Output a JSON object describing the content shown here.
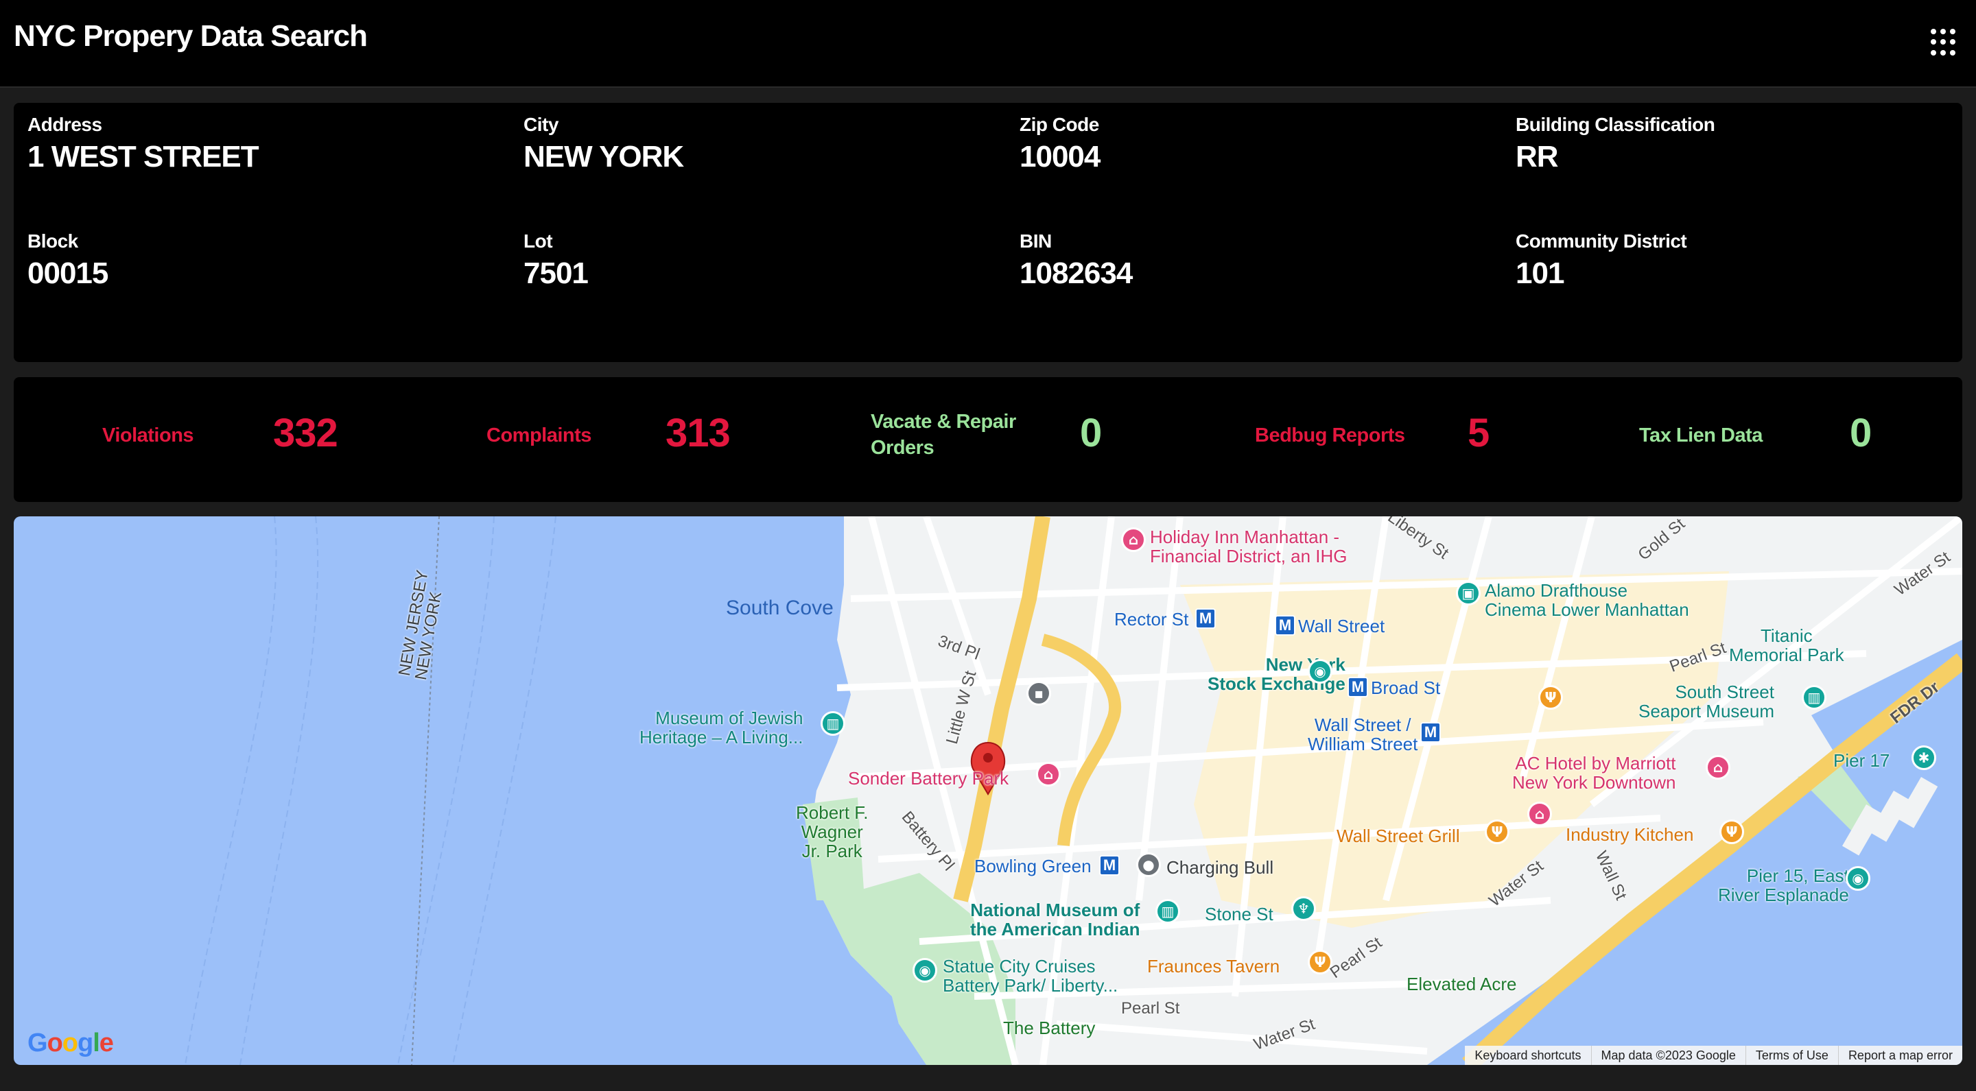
{
  "app": {
    "title": "NYC Propery Data Search"
  },
  "property": {
    "address_label": "Address",
    "address": "1 WEST STREET",
    "city_label": "City",
    "city": "NEW YORK",
    "zip_label": "Zip Code",
    "zip": "10004",
    "classification_label": "Building Classification",
    "classification": "RR",
    "block_label": "Block",
    "block": "00015",
    "lot_label": "Lot",
    "lot": "7501",
    "bin_label": "BIN",
    "bin": "1082634",
    "district_label": "Community District",
    "district": "101"
  },
  "stats": {
    "violations_label": "Violations",
    "violations": "332",
    "complaints_label": "Complaints",
    "complaints": "313",
    "vacate_label_1": "Vacate & Repair",
    "vacate_label_2": "Orders",
    "vacate": "0",
    "bedbug_label": "Bedbug Reports",
    "bedbug": "5",
    "taxlien_label": "Tax Lien Data",
    "taxlien": "0"
  },
  "colors": {
    "alert": "#e3173e",
    "ok": "#9be39b"
  },
  "map": {
    "water_labels": {
      "south_cove": "South Cove"
    },
    "border_labels": {
      "nj": "NEW JERSEY",
      "ny": "NEW YORK"
    },
    "pois": {
      "holiday_inn_1": "Holiday Inn Manhattan -",
      "holiday_inn_2": "Financial District, an IHG",
      "alamo_1": "Alamo Drafthouse",
      "alamo_2": "Cinema Lower Manhattan",
      "rector": "Rector St",
      "wall_street": "Wall Street",
      "titanic_1": "Titanic",
      "titanic_2": "Memorial Park",
      "nyse_1": "New York",
      "nyse_2": "Stock Exchange",
      "broad": "Broad St",
      "seaport_1": "South Street",
      "seaport_2": "Seaport Museum",
      "jewish_1": "Museum of Jewish",
      "jewish_2": "Heritage – A Living...",
      "wall_william_1": "Wall Street /",
      "wall_william_2": "William Street",
      "ac_hotel_1": "AC Hotel by Marriott",
      "ac_hotel_2": "New York Downtown",
      "pier17": "Pier 17",
      "sonder": "Sonder Battery Park",
      "wagner_1": "Robert F.",
      "wagner_2": "Wagner",
      "wagner_3": "Jr. Park",
      "wsg": "Wall Street Grill",
      "industry": "Industry Kitchen",
      "bowling": "Bowling Green",
      "charging_bull": "Charging Bull",
      "pier15_1": "Pier 15, East",
      "pier15_2": "River Esplanade",
      "nmai_1": "National Museum of",
      "nmai_2": "the American Indian",
      "stone": "Stone St",
      "statue_1": "Statue City Cruises",
      "statue_2": "Battery Park/ Liberty...",
      "fraunces": "Fraunces Tavern",
      "elevated": "Elevated Acre",
      "battery": "The Battery"
    },
    "streets": {
      "third_pl": "3rd Pl",
      "little_w": "Little W St",
      "battery_pl": "Battery Pl",
      "pearl_1": "Pearl St",
      "pearl_2": "Pearl St",
      "pearl_3": "Pearl St",
      "water_1": "Water St",
      "water_2": "Water St",
      "water_3": "Water St",
      "wall_st": "Wall St",
      "gold": "Gold St",
      "fdr": "FDR Dr",
      "liberty": "Liberty St"
    },
    "logo": "Google",
    "footer": {
      "shortcuts": "Keyboard shortcuts",
      "mapdata": "Map data ©2023 Google",
      "terms": "Terms of Use",
      "report": "Report a map error"
    }
  }
}
